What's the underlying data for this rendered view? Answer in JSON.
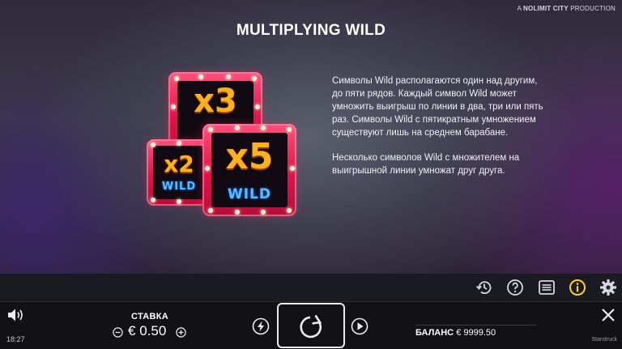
{
  "header": {
    "brand_prefix": "A",
    "brand_name": "NOLIMIT CITY",
    "brand_suffix": "PRODUCTION"
  },
  "info": {
    "title": "MULTIPLYING WILD",
    "paragraph_1": "Символы Wild располагаются один над другим, до пяти рядов. Каждый символ Wild может умножить выигрыш по линии в два, три или пять раз. Символы Wild с пятикратным умножением существуют лишь на среднем барабане.",
    "paragraph_2": "Несколько символов Wild с множителем на выигрышной линии умножат друг друга."
  },
  "symbols": [
    {
      "id": "x3",
      "multiplier": "x3",
      "label": "WILD"
    },
    {
      "id": "x2",
      "multiplier": "x2",
      "label": "WILD"
    },
    {
      "id": "x5",
      "multiplier": "x5",
      "label": "WILD"
    }
  ],
  "toolbar": {
    "icons": [
      "history-icon",
      "help-icon",
      "paytable-icon",
      "info-icon",
      "settings-icon"
    ],
    "active_icon": "info-icon",
    "active_color": "#ffd21e"
  },
  "bottom_bar": {
    "bet_label": "СТАВКА",
    "bet_currency": "€",
    "bet_value": "0.50",
    "balance_label": "БАЛАНС",
    "balance_value": "€ 9999.50",
    "time": "18:27",
    "game_name": "Starstruck"
  },
  "colors": {
    "frame_red": "#e2124a",
    "multiplier_gold": "#ffb21c",
    "wild_blue": "#4ec2ff"
  }
}
